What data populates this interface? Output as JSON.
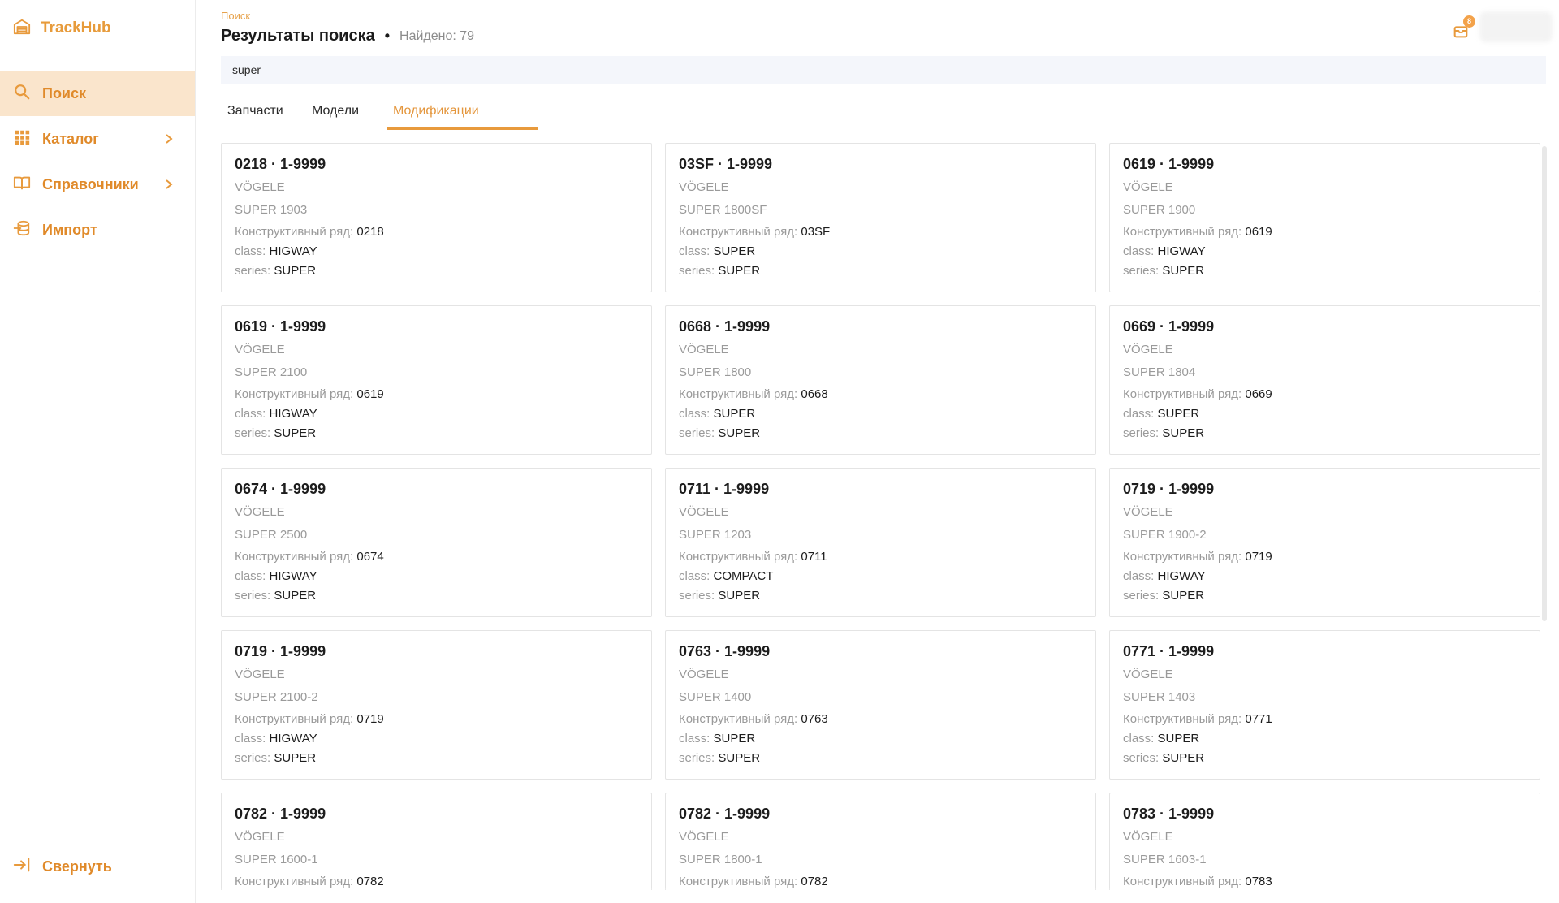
{
  "app": {
    "name": "TrackHub",
    "accent": "#e89a3c"
  },
  "sidebar": {
    "items": [
      {
        "label": "Поиск",
        "icon": "search-icon",
        "active": true
      },
      {
        "label": "Каталог",
        "icon": "grid-icon",
        "chevron": true
      },
      {
        "label": "Справочники",
        "icon": "book-icon",
        "chevron": true
      },
      {
        "label": "Импорт",
        "icon": "database-import-icon"
      }
    ],
    "collapse_label": "Свернуть"
  },
  "header": {
    "breadcrumb": "Поиск",
    "title": "Результаты поиска",
    "separator": "•",
    "found": "Найдено: 79",
    "notification_count": "8"
  },
  "search": {
    "value": "super"
  },
  "tabs": [
    {
      "label": "Запчасти",
      "active": false
    },
    {
      "label": "Модели",
      "active": false
    },
    {
      "label": "Модификации",
      "active": true
    }
  ],
  "labels": {
    "row": "Конструктивный ряд:",
    "class": "class:",
    "series": "series:"
  },
  "cards": [
    {
      "title": "0218 · 1-9999",
      "brand": "VÖGELE",
      "model": "SUPER 1903",
      "row": "0218",
      "class": "HIGWAY",
      "series": "SUPER"
    },
    {
      "title": "03SF · 1-9999",
      "brand": "VÖGELE",
      "model": "SUPER 1800SF",
      "row": "03SF",
      "class": "SUPER",
      "series": "SUPER"
    },
    {
      "title": "0619 · 1-9999",
      "brand": "VÖGELE",
      "model": "SUPER 1900",
      "row": "0619",
      "class": "HIGWAY",
      "series": "SUPER"
    },
    {
      "title": "0619 · 1-9999",
      "brand": "VÖGELE",
      "model": "SUPER 2100",
      "row": "0619",
      "class": "HIGWAY",
      "series": "SUPER"
    },
    {
      "title": "0668 · 1-9999",
      "brand": "VÖGELE",
      "model": "SUPER 1800",
      "row": "0668",
      "class": "SUPER",
      "series": "SUPER"
    },
    {
      "title": "0669 · 1-9999",
      "brand": "VÖGELE",
      "model": "SUPER 1804",
      "row": "0669",
      "class": "SUPER",
      "series": "SUPER"
    },
    {
      "title": "0674 · 1-9999",
      "brand": "VÖGELE",
      "model": "SUPER 2500",
      "row": "0674",
      "class": "HIGWAY",
      "series": "SUPER"
    },
    {
      "title": "0711 · 1-9999",
      "brand": "VÖGELE",
      "model": "SUPER 1203",
      "row": "0711",
      "class": "COMPACT",
      "series": "SUPER"
    },
    {
      "title": "0719 · 1-9999",
      "brand": "VÖGELE",
      "model": "SUPER 1900-2",
      "row": "0719",
      "class": "HIGWAY",
      "series": "SUPER"
    },
    {
      "title": "0719 · 1-9999",
      "brand": "VÖGELE",
      "model": "SUPER 2100-2",
      "row": "0719",
      "class": "HIGWAY",
      "series": "SUPER"
    },
    {
      "title": "0763 · 1-9999",
      "brand": "VÖGELE",
      "model": "SUPER 1400",
      "row": "0763",
      "class": "SUPER",
      "series": "SUPER"
    },
    {
      "title": "0771 · 1-9999",
      "brand": "VÖGELE",
      "model": "SUPER 1403",
      "row": "0771",
      "class": "SUPER",
      "series": "SUPER"
    },
    {
      "title": "0782 · 1-9999",
      "brand": "VÖGELE",
      "model": "SUPER 1600-1",
      "row": "0782",
      "class": "",
      "series": ""
    },
    {
      "title": "0782 · 1-9999",
      "brand": "VÖGELE",
      "model": "SUPER 1800-1",
      "row": "0782",
      "class": "",
      "series": ""
    },
    {
      "title": "0783 · 1-9999",
      "brand": "VÖGELE",
      "model": "SUPER 1603-1",
      "row": "0783",
      "class": "",
      "series": ""
    }
  ]
}
